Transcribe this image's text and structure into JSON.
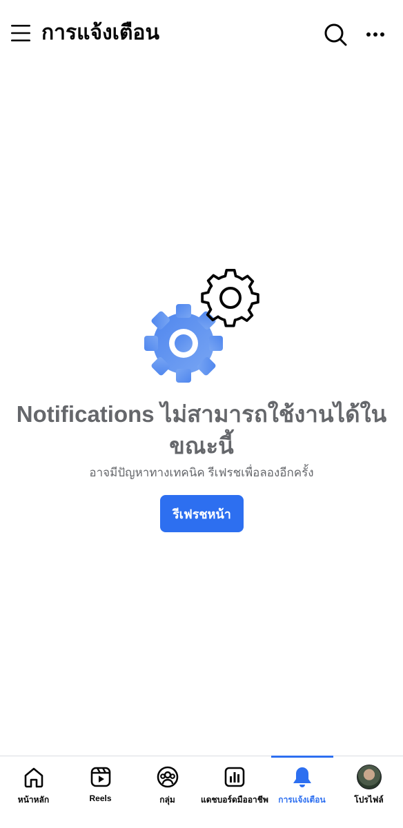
{
  "header": {
    "title": "การแจ้งเตือน",
    "menu_icon": "hamburger-icon",
    "search_icon": "search-icon",
    "more_icon": "more-horizontal-icon"
  },
  "empty_state": {
    "illustration": "gears-icon",
    "title": "Notifications ไม่สามารถใช้งานได้ในขณะนี้",
    "subtitle": "อาจมีปัญหาทางเทคนิค รีเฟรชเพื่อลองอีกครั้ง",
    "button_label": "รีเฟรชหน้า"
  },
  "bottom_nav": {
    "items": [
      {
        "label": "หน้าหลัก",
        "icon": "home-icon",
        "active": false
      },
      {
        "label": "Reels",
        "icon": "reels-icon",
        "active": false
      },
      {
        "label": "กลุ่ม",
        "icon": "groups-icon",
        "active": false
      },
      {
        "label": "แดชบอร์ดมืออาชีพ",
        "icon": "dashboard-icon",
        "active": false
      },
      {
        "label": "การแจ้งเตือน",
        "icon": "bell-icon",
        "active": true
      },
      {
        "label": "โปรไฟล์",
        "icon": "avatar",
        "active": false
      }
    ]
  },
  "colors": {
    "accent": "#2d6ff0",
    "secondary_text": "#65676b",
    "primary_text": "#050505",
    "gear_blue": "#5b8ef0"
  }
}
